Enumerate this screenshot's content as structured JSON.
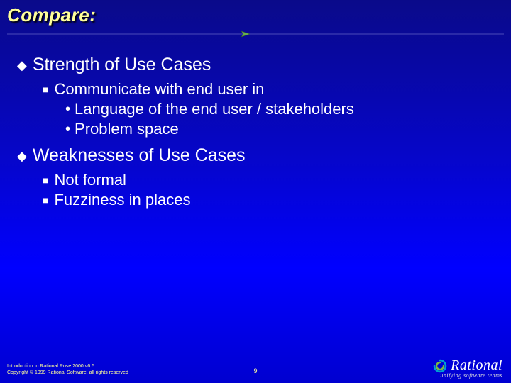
{
  "title": "Compare:",
  "sections": [
    {
      "heading": "Strength of Use Cases",
      "items": [
        {
          "text": "Communicate with end user in",
          "sub": [
            "Language of the end user / stakeholders",
            "Problem space"
          ]
        }
      ]
    },
    {
      "heading": "Weaknesses of Use Cases",
      "items": [
        {
          "text": "Not formal",
          "sub": []
        },
        {
          "text": "Fuzziness in places",
          "sub": []
        }
      ]
    }
  ],
  "footer": {
    "line1": "Introduction to Rational Rose 2000 v6.5",
    "line2": "Copyright © 1999 Rational Software, all rights reserved",
    "page": "9",
    "brand": "Rational",
    "tagline": "unifying software teams"
  }
}
